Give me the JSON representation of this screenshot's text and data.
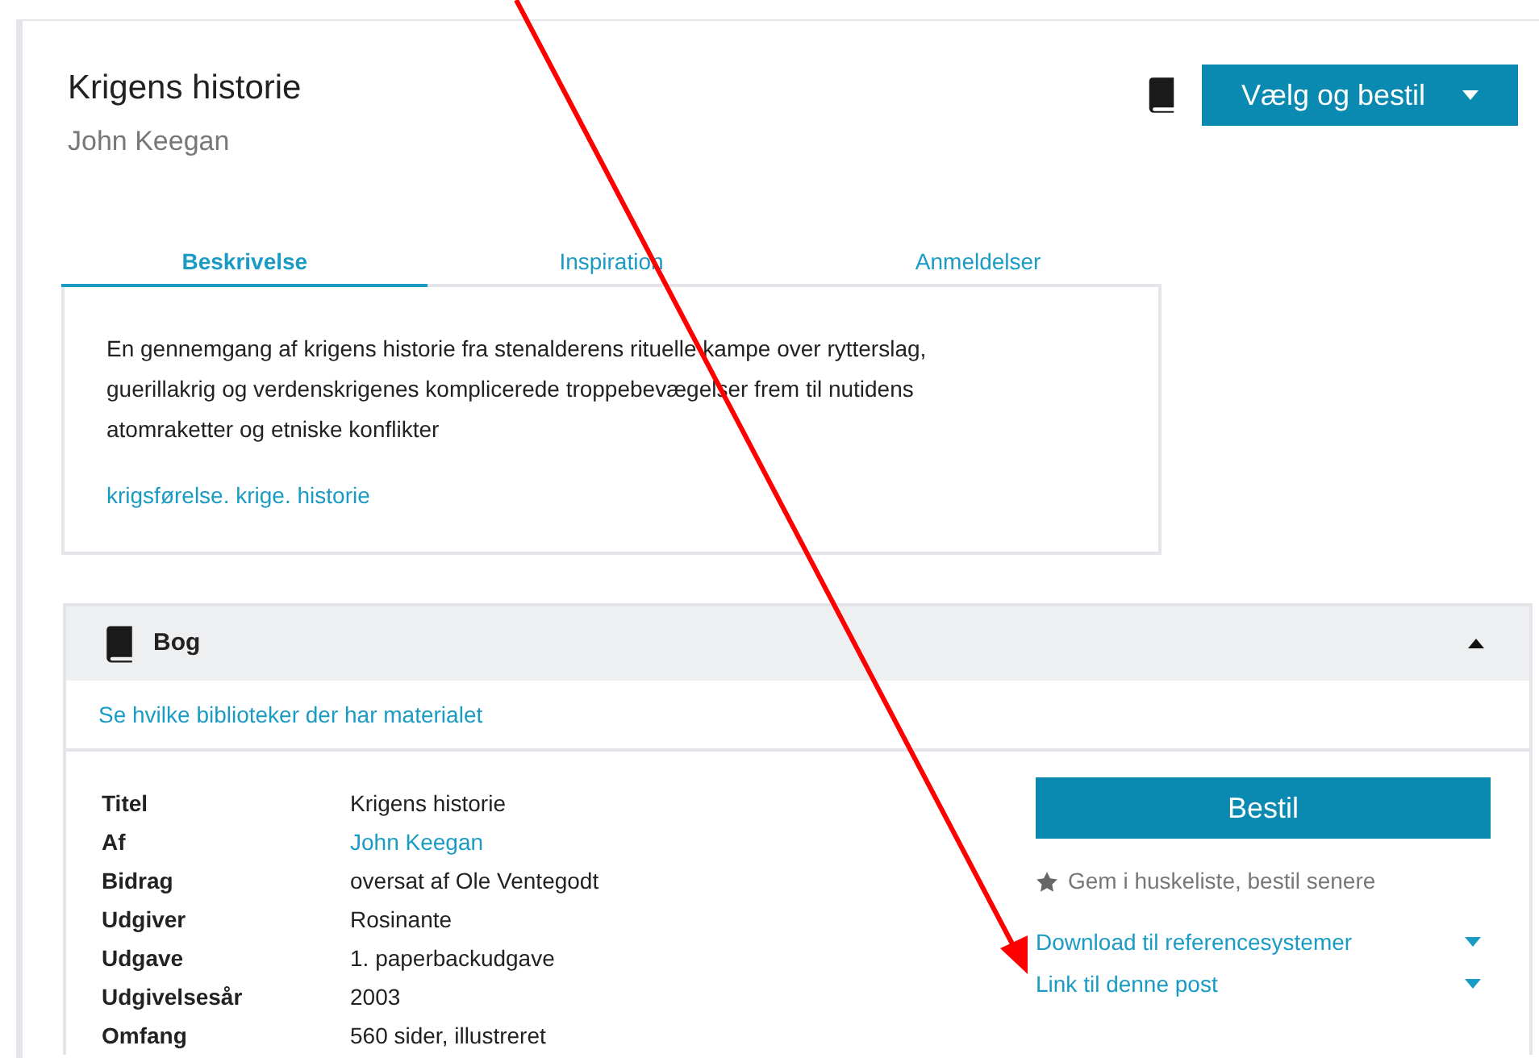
{
  "header": {
    "title": "Krigens historie",
    "author": "John Keegan",
    "order_button": "Vælg og bestil"
  },
  "tabs": [
    {
      "label": "Beskrivelse",
      "selected": true
    },
    {
      "label": "Inspiration",
      "selected": false
    },
    {
      "label": "Anmeldelser",
      "selected": false
    }
  ],
  "description": {
    "text": "En gennemgang af krigens historie fra stenalderens rituelle kampe over rytterslag, guerillakrig og verdenskrigenes komplicerede troppebevægelser frem til nutidens atomraketter og etniske konflikter",
    "subjects": "krigsførelse. krige. historie"
  },
  "material": {
    "type": "Bog",
    "expanded": true,
    "libraries_link": "Se hvilke biblioteker der har materialet",
    "details": [
      {
        "label": "Titel",
        "value": "Krigens historie",
        "link": false
      },
      {
        "label": "Af",
        "value": "John Keegan",
        "link": true
      },
      {
        "label": "Bidrag",
        "value": "oversat af Ole Ventegodt",
        "link": false
      },
      {
        "label": "Udgiver",
        "value": "Rosinante",
        "link": false
      },
      {
        "label": "Udgave",
        "value": "1. paperbackudgave",
        "link": false
      },
      {
        "label": "Udgivelsesår",
        "value": "2003",
        "link": false
      },
      {
        "label": "Omfang",
        "value": "560 sider, illustreret",
        "link": false
      }
    ],
    "order_button": "Bestil",
    "save_link": "Gem i huskeliste, bestil senere",
    "dropdown_links": [
      "Download til referencesystemer",
      "Link til denne post"
    ]
  }
}
